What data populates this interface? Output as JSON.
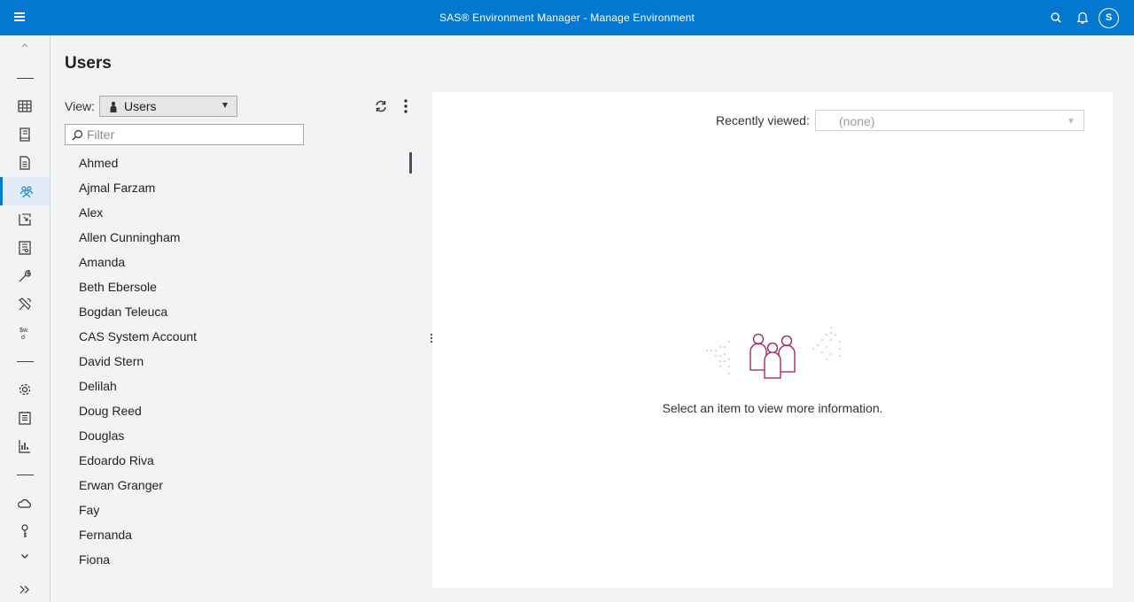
{
  "header": {
    "title": "SAS® Environment Manager - Manage Environment",
    "avatar_initial": "S"
  },
  "rail": {
    "icons": [
      "chevron-up-icon",
      "grid-icon",
      "book-icon",
      "document-icon",
      "users-icon",
      "import-icon",
      "report-icon",
      "wrench-icon",
      "tools-icon",
      "format-icon",
      "gear-icon",
      "log-icon",
      "dashboard-icon",
      "cloud-icon",
      "key-icon",
      "chevron-down-icon",
      "expand-icon"
    ],
    "active": "users-icon"
  },
  "page": {
    "title": "Users"
  },
  "toolbar": {
    "view_label": "View:",
    "view_value": "Users",
    "filter_placeholder": "Filter"
  },
  "users": [
    "Ahmed",
    "Ajmal Farzam",
    "Alex",
    "Allen Cunningham",
    "Amanda",
    "Beth Ebersole",
    "Bogdan Teleuca",
    "CAS System Account",
    "David Stern",
    "Delilah",
    "Doug Reed",
    "Douglas",
    "Edoardo Riva",
    "Erwan Granger",
    "Fay",
    "Fernanda",
    "Fiona"
  ],
  "detail": {
    "recent_label": "Recently viewed:",
    "recent_value": "(none)",
    "empty_message": "Select an item to view more information."
  },
  "colors": {
    "brand": "#0478d0",
    "illustration": "#9b1c5e"
  }
}
